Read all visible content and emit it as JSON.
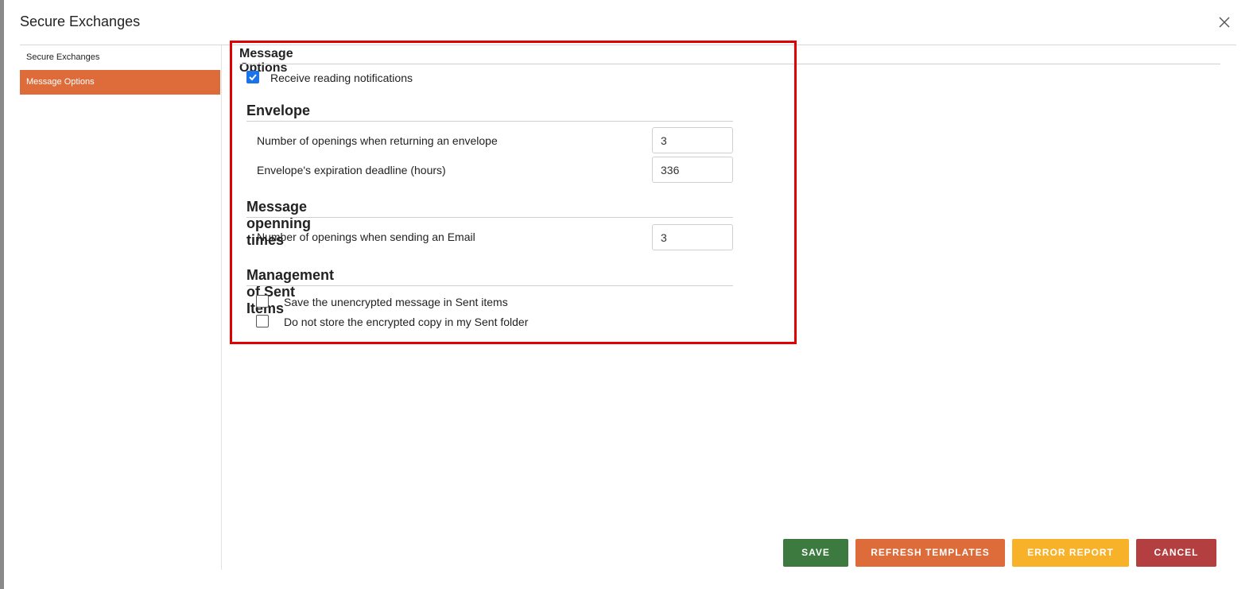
{
  "dialog": {
    "title": "Secure Exchanges"
  },
  "sidebar": {
    "items": [
      {
        "label": "Secure Exchanges",
        "active": false
      },
      {
        "label": "Message Options",
        "active": true
      }
    ]
  },
  "main": {
    "title": "Message Options",
    "reading_notifications": {
      "label": "Receive reading notifications",
      "checked": true
    },
    "envelope": {
      "title": "Envelope",
      "openings_label": "Number of openings when returning an envelope",
      "openings_value": "3",
      "expiration_label": "Envelope's expiration deadline (hours)",
      "expiration_value": "336"
    },
    "opening_times": {
      "title": "Message openning times",
      "email_openings_label": "Number of openings when sending an Email",
      "email_openings_value": "3"
    },
    "sent_items": {
      "title": "Management of Sent Items",
      "save_unencrypted": {
        "label": "Save the unencrypted message in Sent items",
        "checked": false
      },
      "no_encrypted_copy": {
        "label": "Do not store the encrypted copy in my Sent folder",
        "checked": false
      }
    }
  },
  "footer": {
    "save": "SAVE",
    "refresh": "REFRESH TEMPLATES",
    "error": "ERROR REPORT",
    "cancel": "CANCEL"
  },
  "colors": {
    "accent": "#de6c3a",
    "save": "#3c7a3f",
    "refresh": "#de6c3a",
    "error": "#f8b22a",
    "cancel": "#b33f40",
    "highlight": "#e10000",
    "checkbox": "#1a73e8"
  }
}
